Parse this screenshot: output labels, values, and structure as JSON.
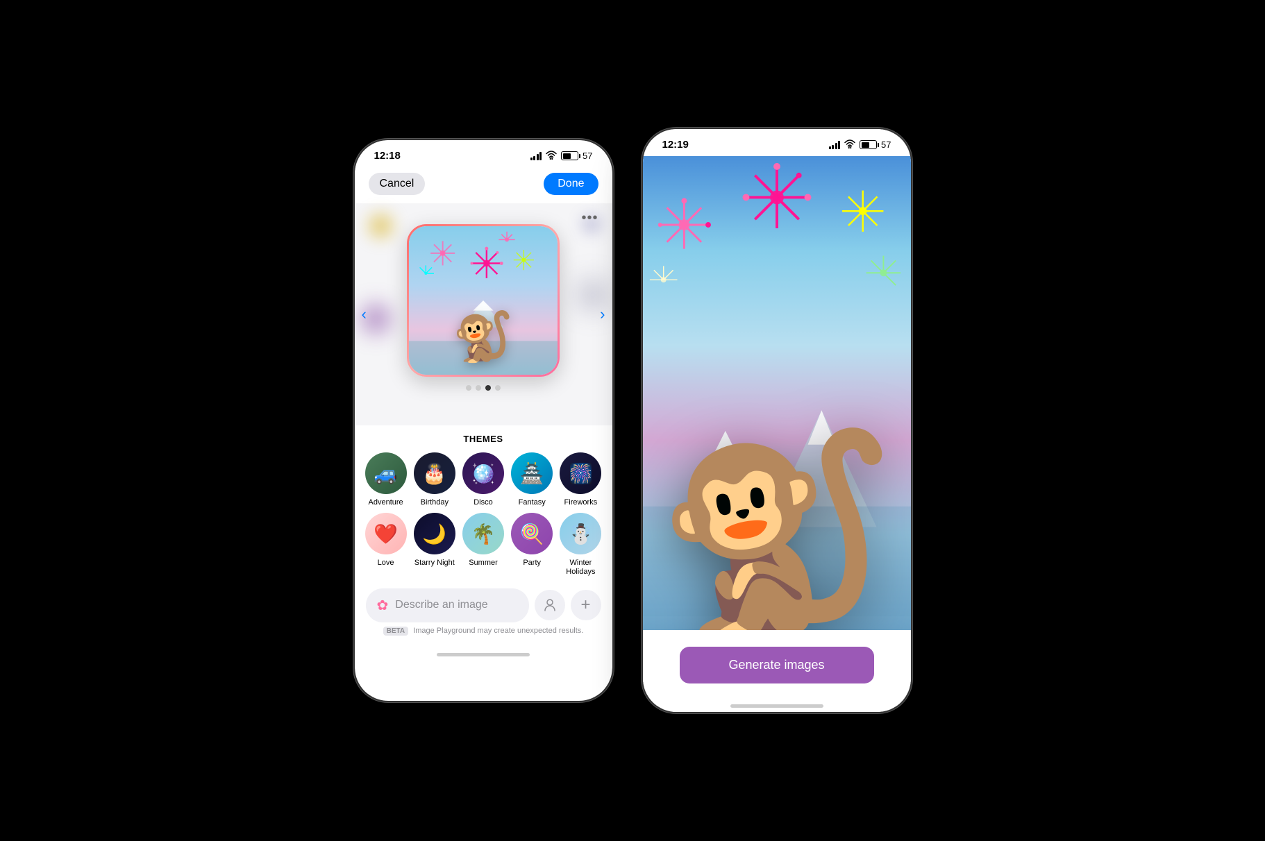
{
  "left_phone": {
    "status": {
      "time": "12:18",
      "battery": "57"
    },
    "nav": {
      "cancel_label": "Cancel",
      "done_label": "Done"
    },
    "more_btn_label": "•••",
    "dots": [
      1,
      2,
      3,
      4
    ],
    "active_dot": 2,
    "themes": {
      "title": "THEMES",
      "items": [
        {
          "id": "adventure",
          "label": "Adventure",
          "emoji": "🚙",
          "class": "theme-adventure"
        },
        {
          "id": "birthday",
          "label": "Birthday",
          "emoji": "🎂",
          "class": "theme-birthday"
        },
        {
          "id": "disco",
          "label": "Disco",
          "emoji": "🪩",
          "class": "theme-disco"
        },
        {
          "id": "fantasy",
          "label": "Fantasy",
          "emoji": "🏯",
          "class": "theme-fantasy"
        },
        {
          "id": "fireworks",
          "label": "Fireworks",
          "emoji": "🎆",
          "class": "theme-fireworks"
        },
        {
          "id": "love",
          "label": "Love",
          "emoji": "❤️",
          "class": "theme-love"
        },
        {
          "id": "starry-night",
          "label": "Starry Night",
          "emoji": "🌙",
          "class": "theme-starry"
        },
        {
          "id": "summer",
          "label": "Summer",
          "emoji": "🌴",
          "class": "theme-summer"
        },
        {
          "id": "party",
          "label": "Party",
          "emoji": "🍭",
          "class": "theme-party"
        },
        {
          "id": "winter-holidays",
          "label": "Winter Holidays",
          "emoji": "☃️",
          "class": "theme-winter"
        }
      ]
    },
    "input": {
      "placeholder": "Describe an image",
      "beta_label": "BETA",
      "notice": "Image Playground may create unexpected results."
    }
  },
  "right_phone": {
    "status": {
      "time": "12:19",
      "battery": "57"
    },
    "generate_btn_label": "Generate images"
  }
}
